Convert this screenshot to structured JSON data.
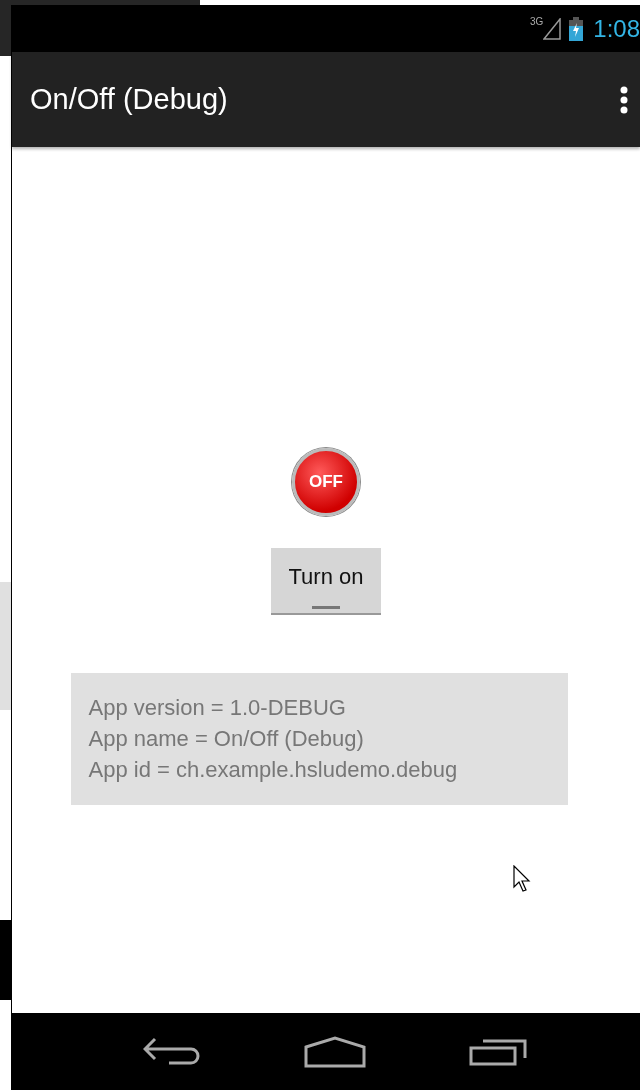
{
  "status_bar": {
    "network": "3G",
    "time": "1:08"
  },
  "action_bar": {
    "title": "On/Off (Debug)"
  },
  "switch": {
    "on": false,
    "icon_label": "OFF",
    "button_label": "Turn on"
  },
  "info": [
    "App version = 1.0-DEBUG",
    "App name = On/Off (Debug)",
    "App id = ch.example.hsludemo.debug"
  ]
}
